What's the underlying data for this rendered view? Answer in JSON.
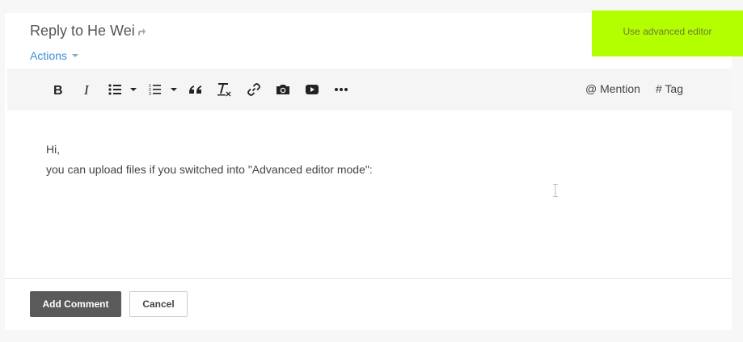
{
  "header": {
    "title": "Reply to He Wei",
    "actions_label": "Actions"
  },
  "advanced_editor": {
    "label": "Use advanced editor",
    "color": "#b3ff00"
  },
  "toolbar": {
    "buttons": [
      {
        "name": "bold",
        "icon": "bold-icon"
      },
      {
        "name": "italic",
        "icon": "italic-icon"
      },
      {
        "name": "bulleted-list",
        "icon": "bulleted-list-icon"
      },
      {
        "name": "numbered-list",
        "icon": "numbered-list-icon"
      },
      {
        "name": "quote",
        "icon": "quote-icon"
      },
      {
        "name": "clear-formatting",
        "icon": "clear-formatting-icon"
      },
      {
        "name": "link",
        "icon": "link-icon"
      },
      {
        "name": "image",
        "icon": "camera-icon"
      },
      {
        "name": "video",
        "icon": "video-icon"
      },
      {
        "name": "more",
        "icon": "more-icon"
      }
    ],
    "mention_label": "@ Mention",
    "tag_label": "# Tag"
  },
  "editor": {
    "lines": [
      "Hi,",
      "you can upload files if you switched into \"Advanced editor mode\":"
    ]
  },
  "footer": {
    "add_label": "Add Comment",
    "cancel_label": "Cancel"
  }
}
